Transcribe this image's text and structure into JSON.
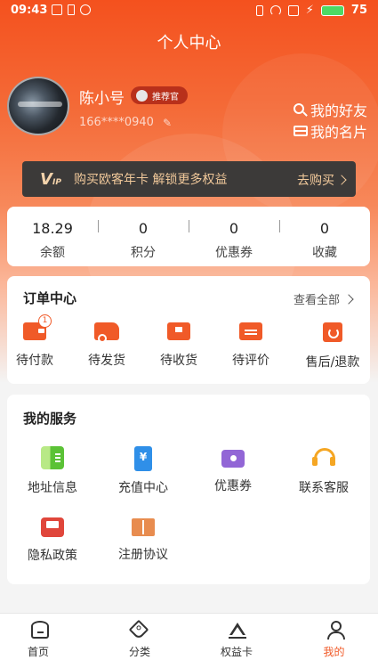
{
  "status_bar": {
    "time": "09:43",
    "battery": "75"
  },
  "header": {
    "title": "个人中心"
  },
  "profile": {
    "name": "陈小号",
    "badge": "推荐官",
    "phone": "166****0940",
    "my_friends": "我的好友",
    "my_card": "我的名片"
  },
  "vip_banner": {
    "text": "购买欧客年卡 解锁更多权益",
    "buy_label": "去购买"
  },
  "stats": [
    {
      "value": "18.29",
      "label": "余额"
    },
    {
      "value": "0",
      "label": "积分"
    },
    {
      "value": "0",
      "label": "优惠券"
    },
    {
      "value": "0",
      "label": "收藏"
    }
  ],
  "orders": {
    "title": "订单中心",
    "see_all": "查看全部",
    "items": [
      {
        "label": "待付款",
        "icon": "wallet-icon",
        "count": "1"
      },
      {
        "label": "待发货",
        "icon": "truck-icon"
      },
      {
        "label": "待收货",
        "icon": "package-icon"
      },
      {
        "label": "待评价",
        "icon": "review-icon"
      },
      {
        "label": "售后/退款",
        "icon": "refund-icon"
      }
    ]
  },
  "services": {
    "title": "我的服务",
    "items": [
      {
        "label": "地址信息",
        "icon": "address-icon"
      },
      {
        "label": "充值中心",
        "icon": "recharge-icon"
      },
      {
        "label": "优惠券",
        "icon": "coupon-icon"
      },
      {
        "label": "联系客服",
        "icon": "headset-icon"
      },
      {
        "label": "隐私政策",
        "icon": "privacy-icon"
      },
      {
        "label": "注册协议",
        "icon": "agreement-icon"
      }
    ]
  },
  "tabbar": {
    "items": [
      {
        "label": "首页",
        "icon": "home-icon"
      },
      {
        "label": "分类",
        "icon": "tag-icon"
      },
      {
        "label": "权益卡",
        "icon": "crown-icon"
      },
      {
        "label": "我的",
        "icon": "user-icon",
        "active": true
      }
    ]
  },
  "colors": {
    "brand": "#f05a28",
    "vip_text": "#f0c89a",
    "vip_bg": "#3c3a39"
  }
}
